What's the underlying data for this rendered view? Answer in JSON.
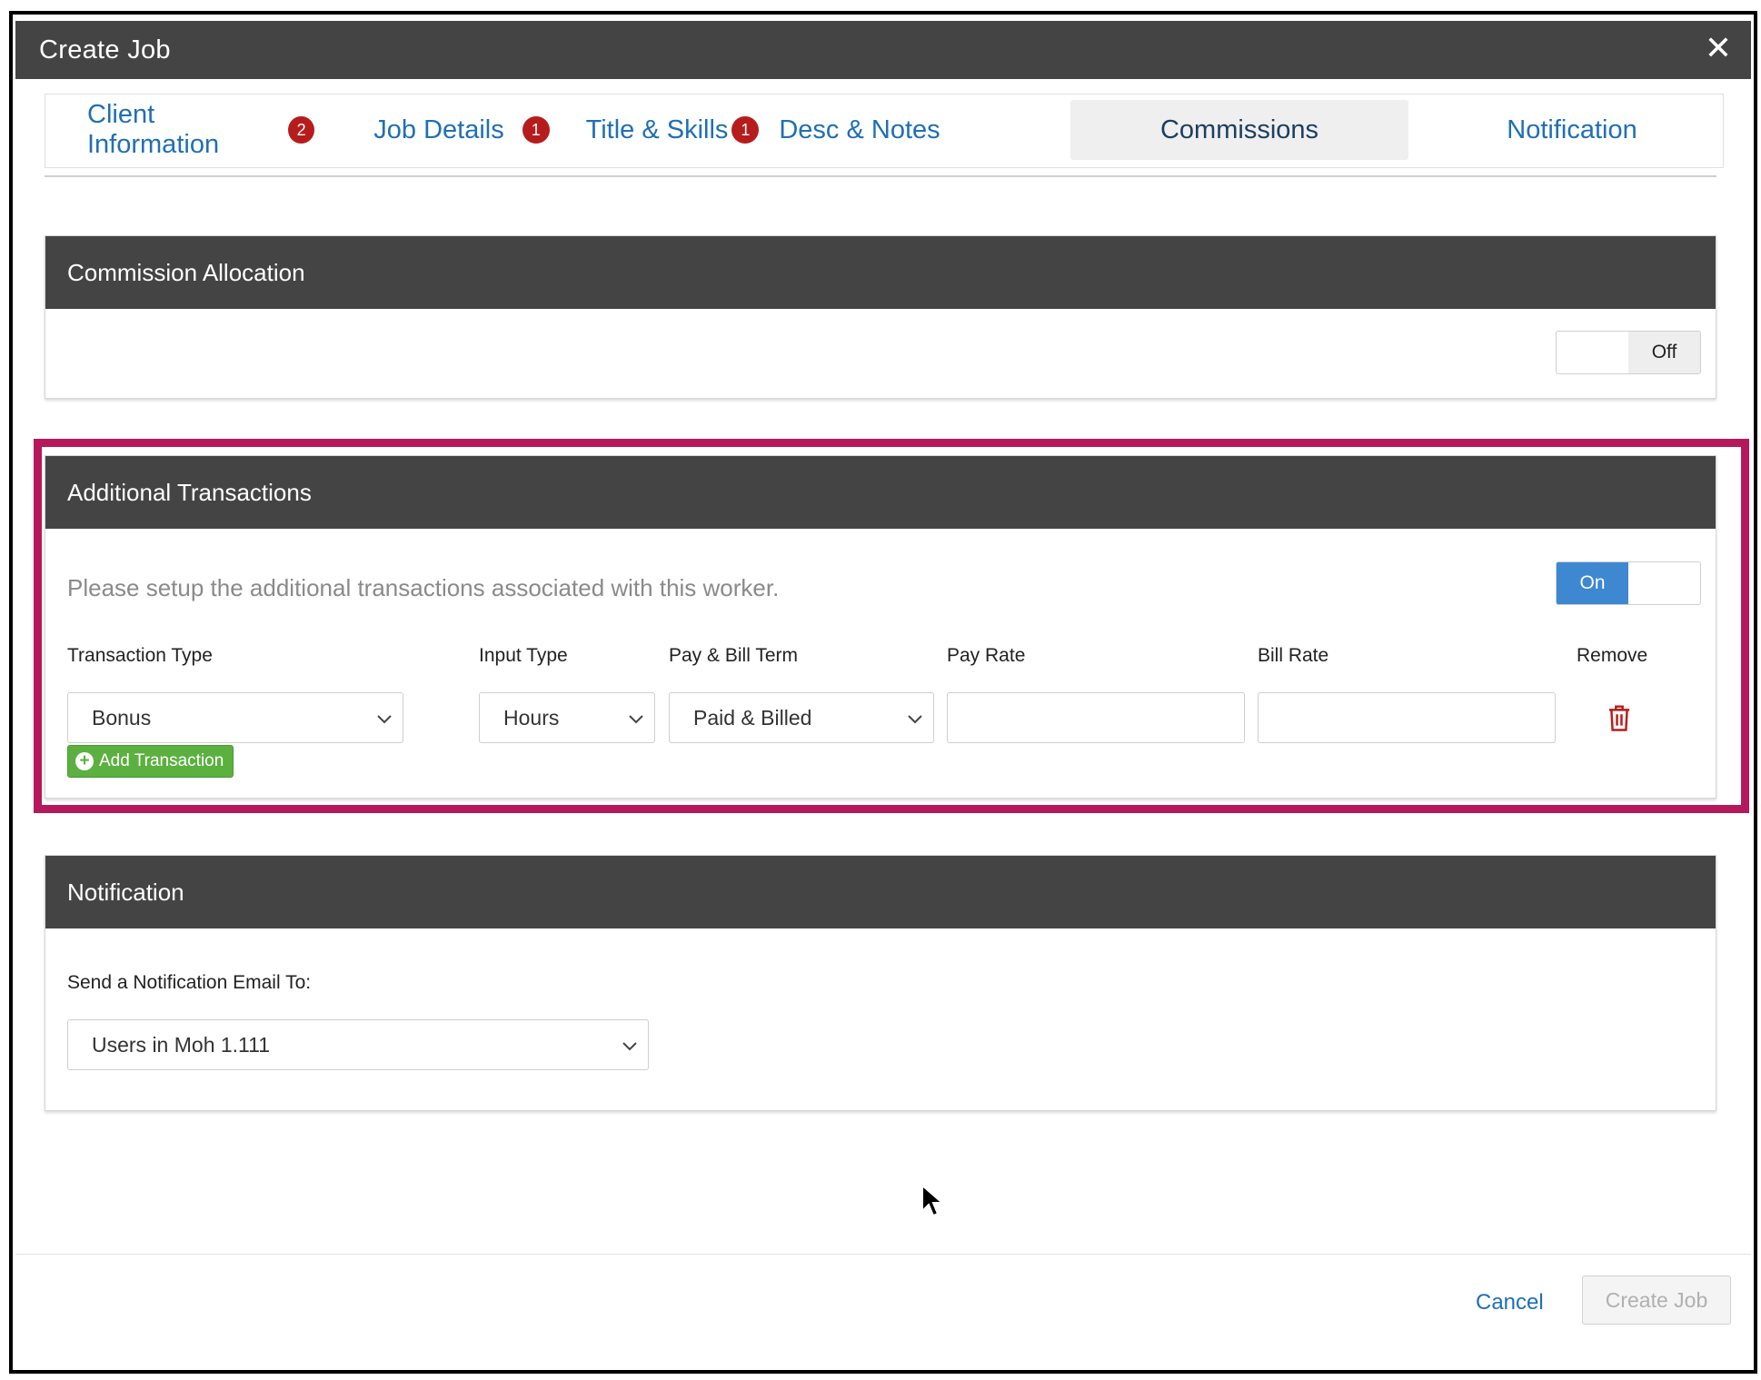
{
  "modal": {
    "title": "Create Job"
  },
  "tabs": [
    {
      "label": "Client Information",
      "badge": "2"
    },
    {
      "label": "Job Details",
      "badge": "1"
    },
    {
      "label": "Title & Skills",
      "badge": "1"
    },
    {
      "label": "Desc & Notes",
      "badge": ""
    },
    {
      "label": "Commissions",
      "badge": "",
      "active": true
    },
    {
      "label": "Notification",
      "badge": ""
    }
  ],
  "commission_allocation": {
    "title": "Commission Allocation",
    "toggle_state": "Off"
  },
  "additional_transactions": {
    "title": "Additional Transactions",
    "hint": "Please setup the additional transactions associated with this worker.",
    "toggle_state": "On",
    "columns": {
      "transaction_type": "Transaction Type",
      "input_type": "Input Type",
      "pay_bill_term": "Pay & Bill Term",
      "pay_rate": "Pay Rate",
      "bill_rate": "Bill Rate",
      "remove": "Remove"
    },
    "row": {
      "transaction_type": "Bonus",
      "input_type": "Hours",
      "pay_bill_term": "Paid & Billed",
      "pay_rate": "",
      "bill_rate": ""
    },
    "add_label": "Add Transaction"
  },
  "notification": {
    "title": "Notification",
    "label": "Send a Notification Email To:",
    "selected": "Users in Moh 1.111"
  },
  "footer": {
    "cancel": "Cancel",
    "create": "Create Job"
  },
  "colors": {
    "header_bg": "#444444",
    "link_blue": "#1f6fb5",
    "toggle_on": "#3e87d1",
    "highlight": "#b5195b",
    "add_green": "#5bb040",
    "badge_red": "#b71c1c",
    "trash_red": "#b71c1c"
  }
}
